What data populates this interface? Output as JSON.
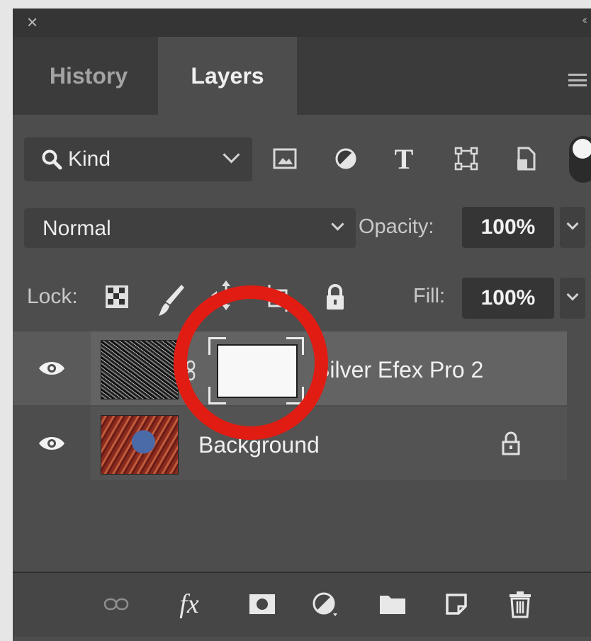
{
  "window": {
    "close_glyph": "×",
    "collapse_glyph": "‹‹"
  },
  "tabs": [
    {
      "label": "History",
      "active": false
    },
    {
      "label": "Layers",
      "active": true
    }
  ],
  "filter": {
    "label": "Kind",
    "icons": [
      "image-filter-icon",
      "adjustment-filter-icon",
      "type-filter-icon",
      "shape-filter-icon",
      "smart-object-filter-icon"
    ],
    "type_glyph": "T"
  },
  "blend": {
    "mode": "Normal",
    "opacity_label": "Opacity:",
    "opacity_value": "100%"
  },
  "lock": {
    "label": "Lock:",
    "fill_label": "Fill:",
    "fill_value": "100%"
  },
  "layers": [
    {
      "name": "Silver Efex Pro 2",
      "visible": true,
      "selected": true,
      "has_mask": true
    },
    {
      "name": "Background",
      "visible": true,
      "selected": false,
      "locked": true
    }
  ],
  "bottom_icons": [
    "link-layers-icon",
    "fx-icon",
    "add-mask-icon",
    "adjustment-layer-icon",
    "new-group-icon",
    "new-layer-icon",
    "delete-icon"
  ],
  "fx_label": "fx",
  "annotation_color": "#e11c13"
}
